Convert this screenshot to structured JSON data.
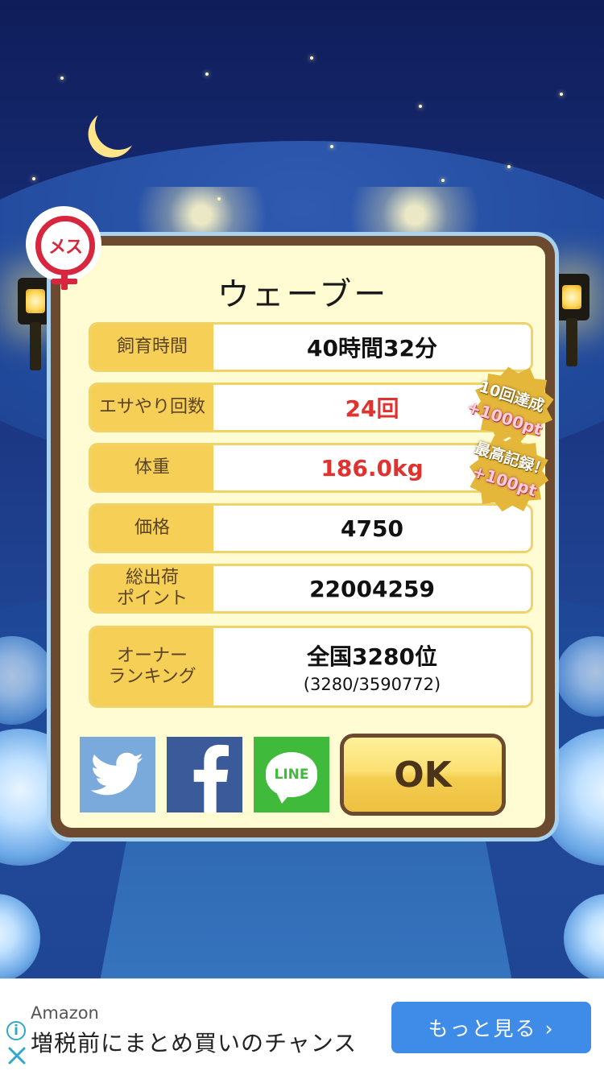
{
  "creature": {
    "name": "ウェーブー",
    "gender_badge": "メス",
    "gender_icon": "female-symbol-icon"
  },
  "stats": [
    {
      "label": "飼育時間",
      "value": "40時間32分",
      "highlight": false
    },
    {
      "label": "エサやり回数",
      "value": "24回",
      "highlight": true
    },
    {
      "label": "体重",
      "value": "186.0kg",
      "highlight": true
    },
    {
      "label": "価格",
      "value": "4750",
      "highlight": false
    },
    {
      "label": "総出荷\nポイント",
      "value": "22004259",
      "highlight": false
    },
    {
      "label": "オーナー\nランキング",
      "value": "全国3280位",
      "sub": "(3280/3590772)",
      "highlight": false
    }
  ],
  "bonuses": [
    {
      "line1": "10回達成",
      "line2": "+1000pt"
    },
    {
      "line1": "最高記録！",
      "line2": "+100pt"
    }
  ],
  "share": {
    "twitter_icon": "twitter-bird-icon",
    "facebook_icon": "facebook-f-icon",
    "line_label": "LINE"
  },
  "ok_label": "OK",
  "ad": {
    "brand": "Amazon",
    "text": "増税前にまとめ買いのチャンス",
    "button": "もっと見る ›"
  },
  "colors": {
    "label_bg": "#f6cf56",
    "highlight_text": "#e0332f",
    "dialog_frame": "#6b4a2f",
    "dialog_bg": "#fffbd2",
    "ad_button": "#3f8be8"
  }
}
